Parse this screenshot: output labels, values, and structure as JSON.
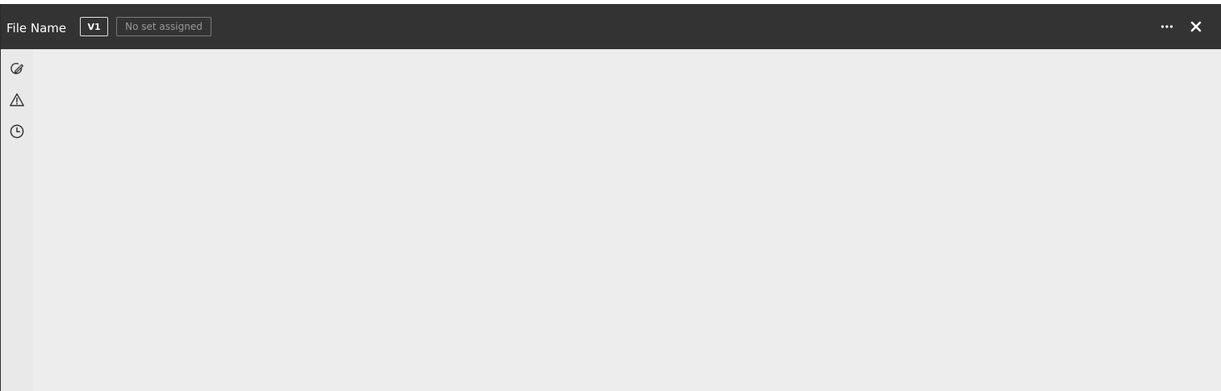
{
  "header": {
    "file_name": "File Name",
    "version_label": "V1",
    "set_label": "No set assigned",
    "actions": [
      {
        "icon": "more-horizontal-icon"
      },
      {
        "icon": "close-icon"
      }
    ]
  },
  "sidebar": {
    "items": [
      {
        "icon": "markup-edit-icon"
      },
      {
        "icon": "warning-icon"
      },
      {
        "icon": "history-clock-icon"
      }
    ]
  },
  "colors": {
    "header_bg": "#333333",
    "canvas_bg": "#ededee",
    "icon": "#333333"
  }
}
